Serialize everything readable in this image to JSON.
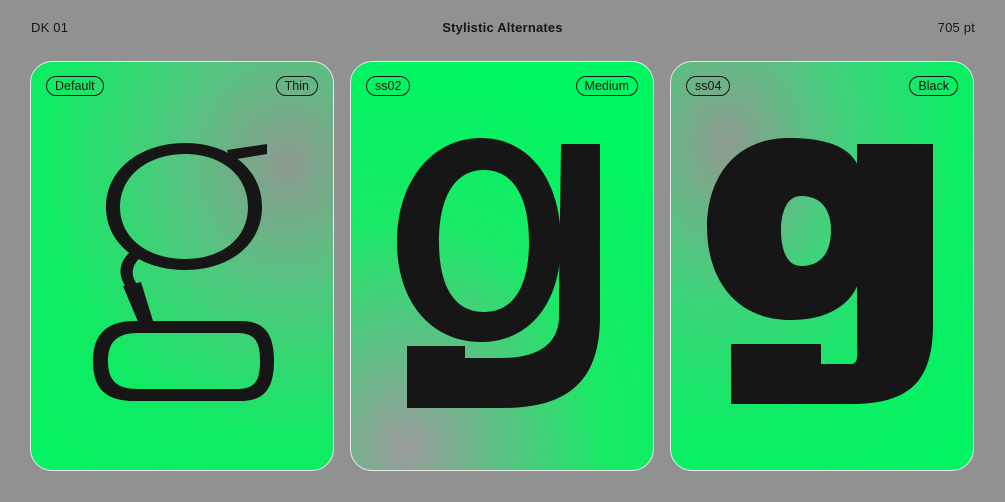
{
  "header": {
    "left": "DK 01",
    "title": "Stylistic Alternates",
    "right": "705 pt"
  },
  "cards": [
    {
      "set": "Default",
      "weight": "Thin",
      "glyph": "g"
    },
    {
      "set": "ss02",
      "weight": "Medium",
      "glyph": "g"
    },
    {
      "set": "ss04",
      "weight": "Black",
      "glyph": "g"
    }
  ],
  "colors": {
    "background": "#919191",
    "accent_green": "#00f562",
    "ink": "#161616",
    "card_border": "#e8e8e8"
  }
}
